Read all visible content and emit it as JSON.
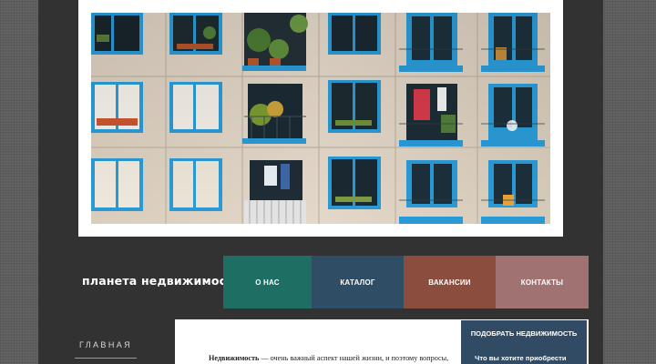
{
  "site": {
    "logo_text": "планета недвижимости"
  },
  "main_nav": [
    {
      "label": "О НАС",
      "color": "#1f6e63"
    },
    {
      "label": "КАТАЛОГ",
      "color": "#2f4e66"
    },
    {
      "label": "ВАКАНСИИ",
      "color": "#8a4d3e"
    },
    {
      "label": "КОНТАКТЫ",
      "color": "#a07272"
    }
  ],
  "sidebar": {
    "items": [
      {
        "label": "ГЛАВНАЯ"
      }
    ]
  },
  "content": {
    "intro_lead": "Недвижимость",
    "intro_rest": " — очень важный аспект нашей жизни, и поэтому вопросы,"
  },
  "filter_panel": {
    "title": "ПОДОБРАТЬ НЕДВИЖИМОСТЬ",
    "question": "Что вы хотите приобрести"
  },
  "colors": {
    "page_background": "#5e5e5e",
    "column_background": "#323232",
    "filter_panel": "#304b63"
  }
}
